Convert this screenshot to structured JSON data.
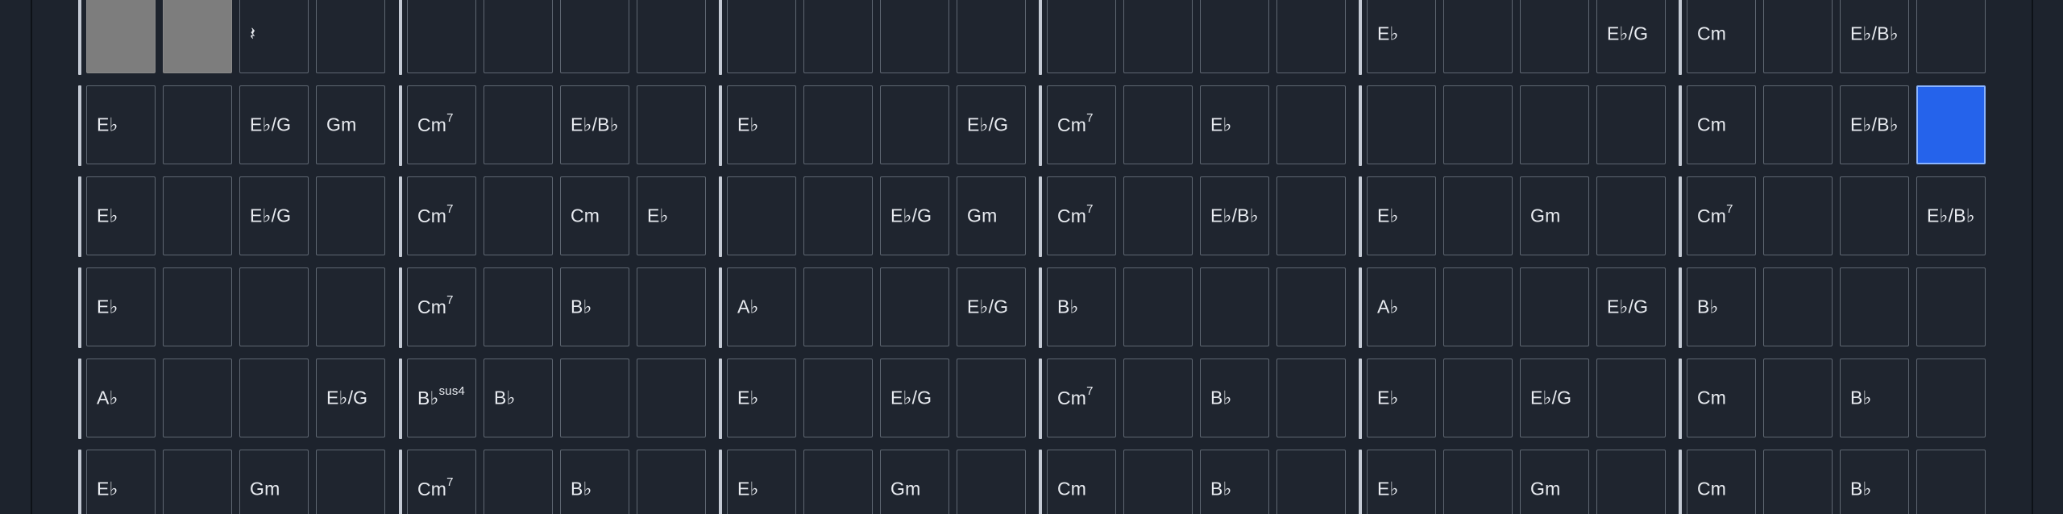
{
  "rows": [
    [
      {
        "chord": "",
        "fill": "gray"
      },
      {
        "chord": "",
        "fill": "gray"
      },
      {
        "chord": "𝄽"
      },
      {
        "chord": ""
      },
      {
        "chord": ""
      },
      {
        "chord": ""
      },
      {
        "chord": ""
      },
      {
        "chord": ""
      },
      {
        "chord": ""
      },
      {
        "chord": ""
      },
      {
        "chord": ""
      },
      {
        "chord": ""
      },
      {
        "chord": ""
      },
      {
        "chord": ""
      },
      {
        "chord": ""
      },
      {
        "chord": ""
      },
      {
        "chord": "E♭"
      },
      {
        "chord": ""
      },
      {
        "chord": ""
      },
      {
        "chord": "E♭/G"
      },
      {
        "chord": "Cm"
      },
      {
        "chord": ""
      },
      {
        "chord": "E♭/B♭"
      },
      {
        "chord": ""
      }
    ],
    [
      {
        "chord": "E♭"
      },
      {
        "chord": ""
      },
      {
        "chord": "E♭/G"
      },
      {
        "chord": "Gm"
      },
      {
        "chord": "Cm",
        "sup": "7"
      },
      {
        "chord": ""
      },
      {
        "chord": "E♭/B♭"
      },
      {
        "chord": ""
      },
      {
        "chord": "E♭"
      },
      {
        "chord": ""
      },
      {
        "chord": ""
      },
      {
        "chord": "E♭/G"
      },
      {
        "chord": "Cm",
        "sup": "7"
      },
      {
        "chord": ""
      },
      {
        "chord": "E♭"
      },
      {
        "chord": ""
      },
      {
        "chord": ""
      },
      {
        "chord": ""
      },
      {
        "chord": ""
      },
      {
        "chord": ""
      },
      {
        "chord": "Cm"
      },
      {
        "chord": ""
      },
      {
        "chord": "E♭/B♭"
      },
      {
        "chord": "",
        "fill": "active"
      }
    ],
    [
      {
        "chord": "E♭"
      },
      {
        "chord": ""
      },
      {
        "chord": "E♭/G"
      },
      {
        "chord": ""
      },
      {
        "chord": "Cm",
        "sup": "7"
      },
      {
        "chord": ""
      },
      {
        "chord": "Cm"
      },
      {
        "chord": "E♭"
      },
      {
        "chord": ""
      },
      {
        "chord": ""
      },
      {
        "chord": "E♭/G"
      },
      {
        "chord": "Gm"
      },
      {
        "chord": "Cm",
        "sup": "7"
      },
      {
        "chord": ""
      },
      {
        "chord": "E♭/B♭"
      },
      {
        "chord": ""
      },
      {
        "chord": "E♭"
      },
      {
        "chord": ""
      },
      {
        "chord": "Gm"
      },
      {
        "chord": ""
      },
      {
        "chord": "Cm",
        "sup": "7"
      },
      {
        "chord": ""
      },
      {
        "chord": ""
      },
      {
        "chord": "E♭/B♭"
      }
    ],
    [
      {
        "chord": "E♭"
      },
      {
        "chord": ""
      },
      {
        "chord": ""
      },
      {
        "chord": ""
      },
      {
        "chord": "Cm",
        "sup": "7"
      },
      {
        "chord": ""
      },
      {
        "chord": "B♭"
      },
      {
        "chord": ""
      },
      {
        "chord": "A♭"
      },
      {
        "chord": ""
      },
      {
        "chord": ""
      },
      {
        "chord": "E♭/G"
      },
      {
        "chord": "B♭"
      },
      {
        "chord": ""
      },
      {
        "chord": ""
      },
      {
        "chord": ""
      },
      {
        "chord": "A♭"
      },
      {
        "chord": ""
      },
      {
        "chord": ""
      },
      {
        "chord": "E♭/G"
      },
      {
        "chord": "B♭"
      },
      {
        "chord": ""
      },
      {
        "chord": ""
      },
      {
        "chord": ""
      }
    ],
    [
      {
        "chord": "A♭"
      },
      {
        "chord": ""
      },
      {
        "chord": ""
      },
      {
        "chord": "E♭/G"
      },
      {
        "chord": "B♭",
        "sup": "sus4"
      },
      {
        "chord": "B♭"
      },
      {
        "chord": ""
      },
      {
        "chord": ""
      },
      {
        "chord": "E♭"
      },
      {
        "chord": ""
      },
      {
        "chord": "E♭/G"
      },
      {
        "chord": ""
      },
      {
        "chord": "Cm",
        "sup": "7"
      },
      {
        "chord": ""
      },
      {
        "chord": "B♭"
      },
      {
        "chord": ""
      },
      {
        "chord": "E♭"
      },
      {
        "chord": ""
      },
      {
        "chord": "E♭/G"
      },
      {
        "chord": ""
      },
      {
        "chord": "Cm"
      },
      {
        "chord": ""
      },
      {
        "chord": "B♭"
      },
      {
        "chord": ""
      }
    ],
    [
      {
        "chord": "E♭"
      },
      {
        "chord": ""
      },
      {
        "chord": "Gm"
      },
      {
        "chord": ""
      },
      {
        "chord": "Cm",
        "sup": "7"
      },
      {
        "chord": ""
      },
      {
        "chord": "B♭"
      },
      {
        "chord": ""
      },
      {
        "chord": "E♭"
      },
      {
        "chord": ""
      },
      {
        "chord": "Gm"
      },
      {
        "chord": ""
      },
      {
        "chord": "Cm"
      },
      {
        "chord": ""
      },
      {
        "chord": "B♭"
      },
      {
        "chord": ""
      },
      {
        "chord": "E♭"
      },
      {
        "chord": ""
      },
      {
        "chord": "Gm"
      },
      {
        "chord": ""
      },
      {
        "chord": "Cm"
      },
      {
        "chord": ""
      },
      {
        "chord": "B♭"
      },
      {
        "chord": ""
      }
    ]
  ]
}
